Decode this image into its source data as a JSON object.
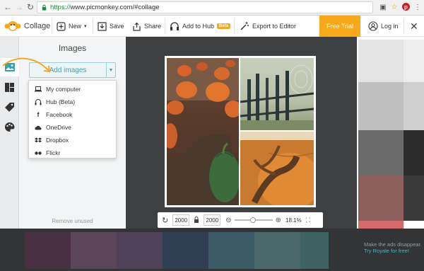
{
  "browser": {
    "url_protocol": "https://",
    "url_rest": "www.picmonkey.com/#collage"
  },
  "header": {
    "app_name": "Collage",
    "new_label": "New",
    "save_label": "Save",
    "share_label": "Share",
    "add_to_hub_label": "Add to Hub",
    "beta_badge": "Beta",
    "export_label": "Export to Editor",
    "free_trial_label": "Free Trial",
    "login_label": "Log in"
  },
  "panel": {
    "title": "Images",
    "add_images_label": "Add images",
    "remove_unused_label": "Remove unused"
  },
  "dropdown": {
    "items": [
      {
        "label": "My computer",
        "icon": "laptop-icon"
      },
      {
        "label": "Hub (Beta)",
        "icon": "hub-icon"
      },
      {
        "label": "Facebook",
        "icon": "facebook-icon"
      },
      {
        "label": "OneDrive",
        "icon": "cloud-icon"
      },
      {
        "label": "Dropbox",
        "icon": "dropbox-icon"
      },
      {
        "label": "Flickr",
        "icon": "flickr-icon"
      }
    ]
  },
  "zoom": {
    "width": "2000",
    "height": "2000",
    "percent": "18.1%"
  },
  "ad": {
    "line1": "Make the ads disappear.",
    "line2": "Try Royale for free!"
  },
  "colors": {
    "accent": "#3aa2ae",
    "free_trial": "#f7a81b",
    "palette": [
      "#4a2f42",
      "#5a4559",
      "#4f4258",
      "#313f55",
      "#3b5b66",
      "#4a6869",
      "#3f6263"
    ]
  }
}
